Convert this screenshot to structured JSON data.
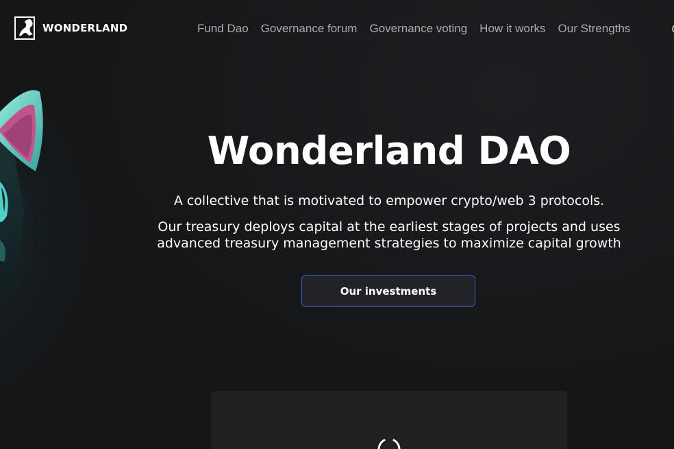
{
  "header": {
    "logo": {
      "icon": "wonderland-logo-icon",
      "text": "WONDERLAND"
    },
    "nav": [
      {
        "label": "Fund Dao"
      },
      {
        "label": "Governance forum"
      },
      {
        "label": "Governance voting"
      },
      {
        "label": "How it works"
      },
      {
        "label": "Our Strengths"
      }
    ]
  },
  "hero": {
    "title": "Wonderland DAO",
    "tagline": "A collective that is motivated to empower crypto/web 3 protocols.",
    "description": "Our treasury deploys capital at the earliest stages of projects and uses advanced treasury management strategies to maximize capital growth",
    "cta_label": "Our investments"
  },
  "loading_panel": {
    "icon": "loading-spinner-icon"
  },
  "colors": {
    "background": "#151618",
    "nav_text": "#a9abb0",
    "button_border": "#3e5bd1",
    "panel": "#202123",
    "cat_accent": "#4fd1c5",
    "cat_ear_inner": "#c2548c"
  }
}
